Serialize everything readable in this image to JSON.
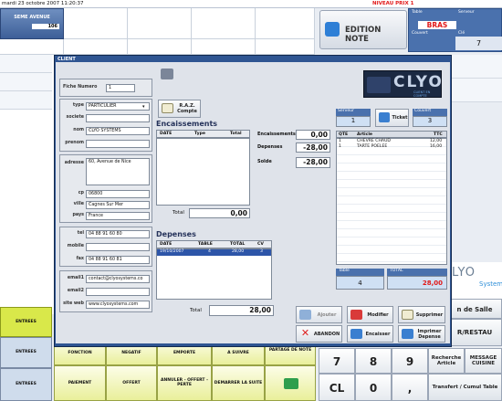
{
  "topbar": {
    "date": "mardi 23 octobre 2007  11:20:37",
    "niveau": "NIVEAU PRIX 1"
  },
  "salle": {
    "label": "SEME AVENUE",
    "value": "106"
  },
  "header": {
    "edition_note": "EDITION NOTE",
    "table_label": "Table",
    "serveur_label": "Serveur",
    "table_value": "BRAS",
    "couvert_label": "Couvert",
    "cle_label": "Clé",
    "cle_value": "7"
  },
  "right": {
    "en_salle": "n de Salle",
    "r_restau": "R/RESTAU",
    "clyo": "LYO",
    "systems": "Systems"
  },
  "modal": {
    "title": "CLIENT",
    "fiche_label": "Fiche Numero",
    "fiche_value": "1",
    "type_label": "type",
    "type_value": "PARTICULIER",
    "societe_label": "societe",
    "societe_value": "",
    "nom_label": "nom",
    "nom_value": "CLYO SYSTEMS",
    "prenom_label": "prenom",
    "prenom_value": "",
    "adresse_label": "adresse",
    "adresse_value": "60, Avenue de Nice",
    "cp_label": "cp",
    "cp_value": "06800",
    "ville_label": "ville",
    "ville_value": "Cagnes Sur Mer",
    "pays_label": "pays",
    "pays_value": "France",
    "tel_label": "tel",
    "tel_value": "04 88 91 60 80",
    "mobile_label": "mobile",
    "mobile_value": "",
    "fax_label": "fax",
    "fax_value": "04 88 91 60 81",
    "email1_label": "email1",
    "email1_value": "contact@clyosystems.co",
    "email2_label": "email2",
    "email2_value": "",
    "site_label": "site web",
    "site_value": "www.clyosystems.com",
    "raz_label": "R.A.Z. Compte",
    "encaissements_title": "Encaissements",
    "enc_cols": [
      "DATE",
      "Type",
      "Total"
    ],
    "enc_total_label": "Total",
    "enc_total_value": "0,00",
    "summary": [
      {
        "label": "Encaissements",
        "value": "0,00"
      },
      {
        "label": "Depenses",
        "value": "-28,00"
      },
      {
        "label": "Solde",
        "value": "-28,00"
      }
    ],
    "depenses_title": "Depenses",
    "dep_cols": [
      "DATE",
      "TABLE",
      "TOTAL",
      "CV"
    ],
    "dep_rows": [
      {
        "date": "19/10/2007",
        "table": "4",
        "total": "28,00",
        "cv": "3"
      }
    ],
    "dep_total_label": "Total",
    "dep_total_value": "28,00",
    "clyo_logo": "CLYO",
    "clyo_sub": "CLIENT EN COMPTE",
    "serveur_label": "Serveur",
    "serveur_value": "1",
    "ticket_label": "Ticket",
    "couvert_label": "Couvert",
    "couvert_value": "3",
    "ticket_cols": [
      "QTE",
      "Article",
      "TTC"
    ],
    "ticket_rows": [
      {
        "qte": "1",
        "article": "CHEVRE CHAUD",
        "ttc": "12,00"
      },
      {
        "qte": "1",
        "article": "TARTE POELEE",
        "ttc": "16,00"
      }
    ],
    "table_label": "Table",
    "table_value": "4",
    "total_label": "TOTAL",
    "total_value": "28,00",
    "buttons": {
      "ajouter": "Ajouter",
      "modifier": "Modifier",
      "supprimer": "Supprimer",
      "abandon": "ABANDON",
      "encaisser": "Encaisser",
      "imprimer": "Imprimer Depense"
    }
  },
  "bottom": {
    "entrees1": "ENTREES",
    "entrees2": "ENTREES",
    "entrees3": "ENTREES",
    "fonction": "FONCTION",
    "negatif": "NEGATIF",
    "emporte": "EMPORTE",
    "a_suivre": "A SUIVRE",
    "partage": "PARTAGE DE NOTE",
    "paiement": "PAIEMENT",
    "offert": "OFFERT",
    "annuler": "ANNULER - OFFERT - PERTE",
    "demarrer": "DEMARRER LA SUITE",
    "keys": [
      "7",
      "8",
      "9",
      "CL",
      "0",
      ","
    ],
    "recherche": "Recherche Article",
    "message": "MESSAGE CUISINE",
    "transfert": "Transfert / Cumul Table"
  }
}
